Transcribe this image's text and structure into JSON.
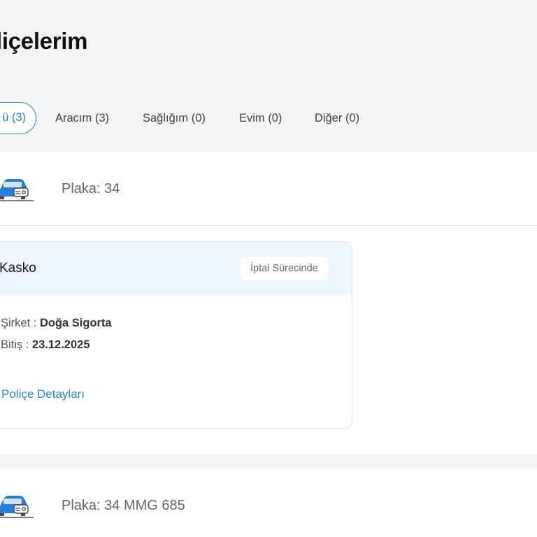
{
  "page": {
    "title": "liçelerim"
  },
  "tabs": [
    {
      "label": "ü (3)",
      "active": true
    },
    {
      "label": "Aracım (3)",
      "active": false
    },
    {
      "label": "Sağlığım (0)",
      "active": false
    },
    {
      "label": "Evim (0)",
      "active": false
    },
    {
      "label": "Diğer (0)",
      "active": false
    }
  ],
  "vehicles": [
    {
      "icon": "car-icon",
      "plate": "Plaka: 34",
      "policies": [
        {
          "type": "Kasko",
          "status": "İptal Sürecinde",
          "company_label": "Şirket : ",
          "company": "Doğa Sigorta",
          "end_label": "Bitiş : ",
          "end_date": "23.12.2025",
          "details_link": "Poliçe Detayları"
        }
      ]
    },
    {
      "icon": "car-icon",
      "plate": "Plaka: 34 MMG 685"
    }
  ],
  "colors": {
    "accent": "#2585c8",
    "background": "#f3f4f5",
    "card_header": "#eef5fc",
    "car_icon": "#2a7fd4"
  }
}
